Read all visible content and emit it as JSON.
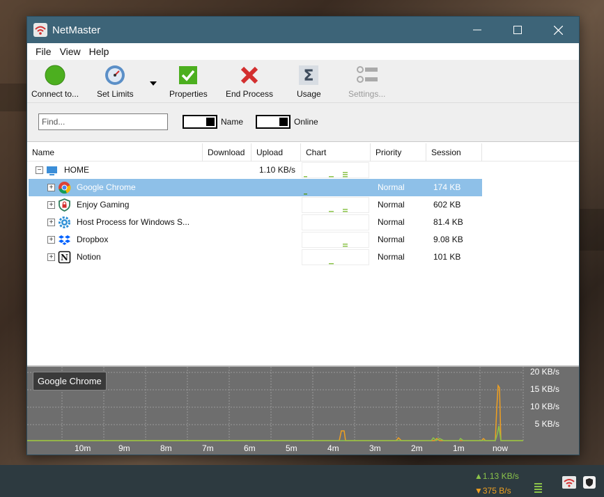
{
  "window": {
    "title": "NetMaster"
  },
  "menu": [
    "File",
    "View",
    "Help"
  ],
  "toolbar": {
    "connect": "Connect to...",
    "set_limits": "Set Limits",
    "properties": "Properties",
    "end_process": "End Process",
    "usage": "Usage",
    "settings": "Settings..."
  },
  "filter": {
    "placeholder": "Find...",
    "name_toggle": "Name",
    "online_toggle": "Online"
  },
  "columns": [
    "Name",
    "Download",
    "Upload",
    "Chart",
    "Priority",
    "Session"
  ],
  "rows": [
    {
      "name": "HOME",
      "download": "",
      "upload": "1.10 KB/s",
      "priority": "",
      "session": "",
      "icon": "computer-icon"
    },
    {
      "name": "Google Chrome",
      "download": "",
      "upload": "",
      "priority": "Normal",
      "session": "174 KB",
      "icon": "chrome-icon"
    },
    {
      "name": "Enjoy Gaming",
      "download": "",
      "upload": "",
      "priority": "Normal",
      "session": "602 KB",
      "icon": "shield-lock-icon"
    },
    {
      "name": "Host Process for Windows S...",
      "download": "",
      "upload": "",
      "priority": "Normal",
      "session": "81.4 KB",
      "icon": "gear-icon"
    },
    {
      "name": "Dropbox",
      "download": "",
      "upload": "",
      "priority": "Normal",
      "session": "9.08 KB",
      "icon": "dropbox-icon"
    },
    {
      "name": "Notion",
      "download": "",
      "upload": "",
      "priority": "Normal",
      "session": "101 KB",
      "icon": "notion-icon"
    }
  ],
  "graph": {
    "selected_app": "Google Chrome",
    "y_labels": [
      "20 KB/s",
      "15 KB/s",
      "10 KB/s",
      "5 KB/s"
    ],
    "x_labels": [
      "10m",
      "9m",
      "8m",
      "7m",
      "6m",
      "5m",
      "4m",
      "3m",
      "2m",
      "1m",
      "now"
    ]
  },
  "tray": {
    "upload": "▲1.13 KB/s",
    "download": "▼375 B/s"
  },
  "colors": {
    "titlebar": "#3d6478",
    "selection": "#8ec0e8",
    "upload_green": "#8bc34a",
    "download_orange": "#f0a020"
  }
}
